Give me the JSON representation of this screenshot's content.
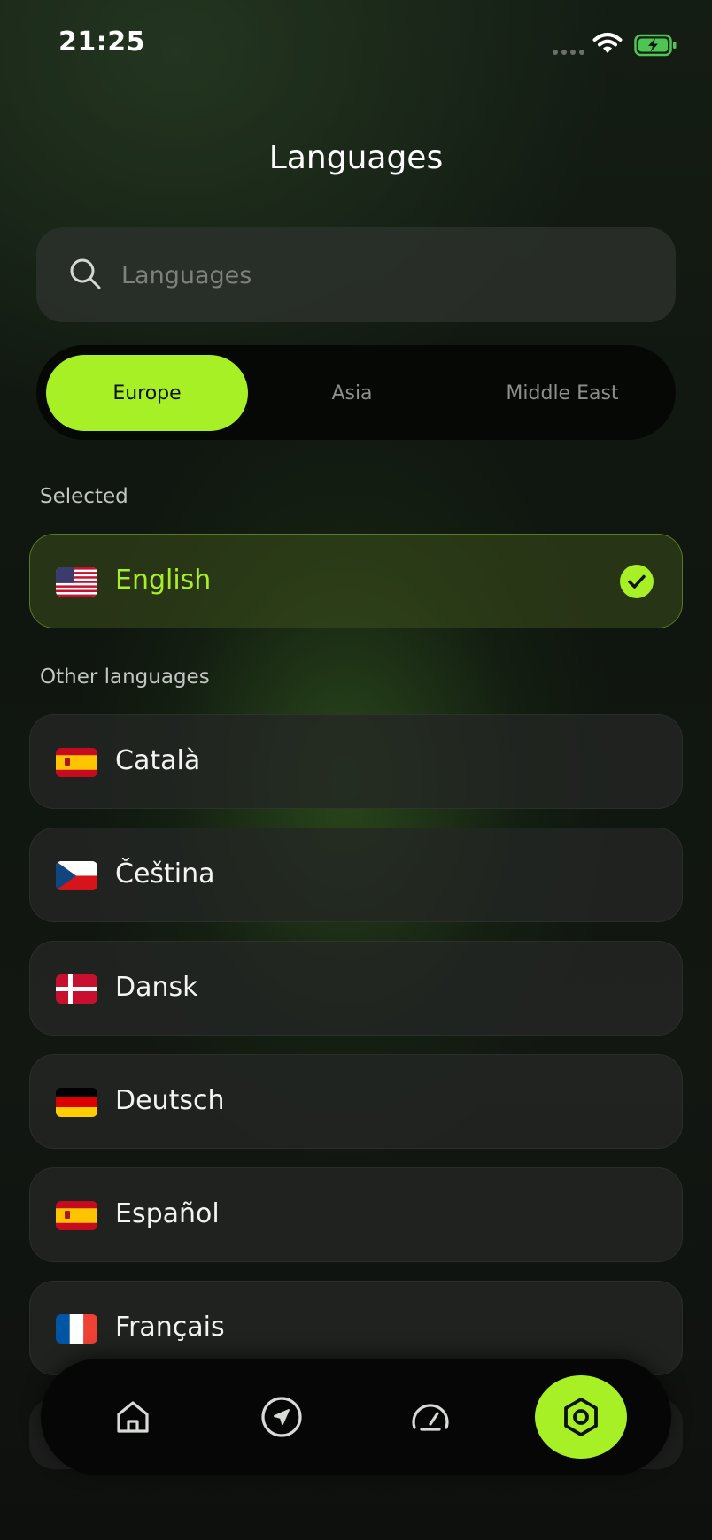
{
  "status_bar": {
    "time": "21:25"
  },
  "header": {
    "title": "Languages"
  },
  "search": {
    "placeholder": "Languages"
  },
  "region_tabs": [
    {
      "label": "Europe",
      "active": true
    },
    {
      "label": "Asia",
      "active": false
    },
    {
      "label": "Middle East",
      "active": false
    }
  ],
  "sections": {
    "selected_label": "Selected",
    "other_label": "Other languages"
  },
  "selected_language": {
    "name": "English",
    "flag": "us-flag-icon"
  },
  "other_languages": [
    {
      "name": "Català",
      "flag": "es-flag-icon"
    },
    {
      "name": "Čeština",
      "flag": "cz-flag-icon"
    },
    {
      "name": "Dansk",
      "flag": "dk-flag-icon"
    },
    {
      "name": "Deutsch",
      "flag": "de-flag-icon"
    },
    {
      "name": "Español",
      "flag": "es-flag-icon"
    },
    {
      "name": "Français",
      "flag": "fr-flag-icon"
    }
  ],
  "bottom_nav": [
    {
      "icon": "home-icon",
      "active": false
    },
    {
      "icon": "navigation-arrow-icon",
      "active": false
    },
    {
      "icon": "speedometer-icon",
      "active": false
    },
    {
      "icon": "settings-hex-icon",
      "active": true
    }
  ],
  "colors": {
    "accent": "#a8f026",
    "background": "#121712",
    "card": "#242724"
  }
}
